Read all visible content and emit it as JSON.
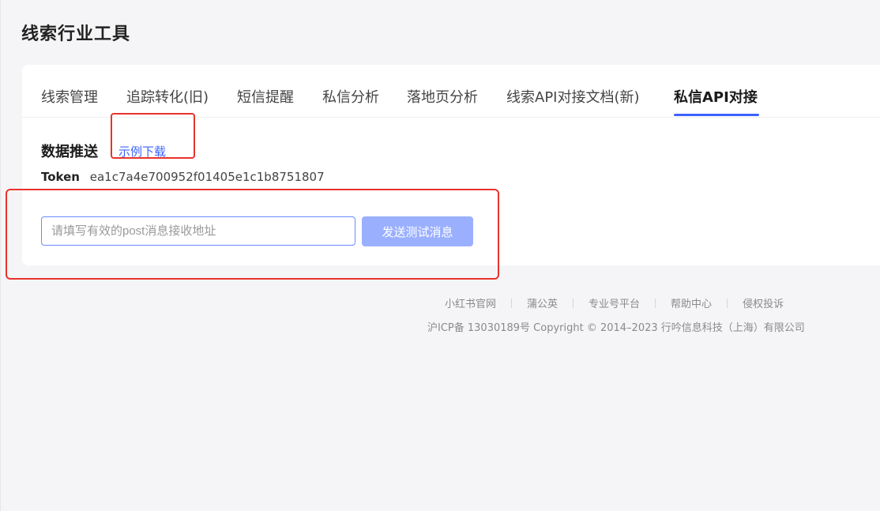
{
  "page": {
    "title": "线索行业工具"
  },
  "tabs": [
    {
      "label": "线索管理",
      "active": false
    },
    {
      "label": "追踪转化(旧)",
      "active": false
    },
    {
      "label": "短信提醒",
      "active": false
    },
    {
      "label": "私信分析",
      "active": false
    },
    {
      "label": "落地页分析",
      "active": false
    },
    {
      "label": "线索API对接文档(新)",
      "active": false
    },
    {
      "label": "私信API对接",
      "active": true
    }
  ],
  "data_push": {
    "title": "数据推送",
    "download_link": "示例下载",
    "token_label": "Token",
    "token_value": "ea1c7a4e700952f01405e1c1b8751807",
    "url_input": {
      "value": "",
      "placeholder": "请填写有效的post消息接收地址"
    },
    "send_button": "发送测试消息"
  },
  "footer": {
    "links": [
      "小红书官网",
      "蒲公英",
      "专业号平台",
      "帮助中心",
      "侵权投诉"
    ],
    "copyright": "沪ICP备 13030189号 Copyright © 2014–2023 行吟信息科技（上海）有限公司"
  },
  "colors": {
    "accent": "#3c63ff",
    "button_disabled": "#9ab0ff",
    "annotation": "#e8332c"
  }
}
